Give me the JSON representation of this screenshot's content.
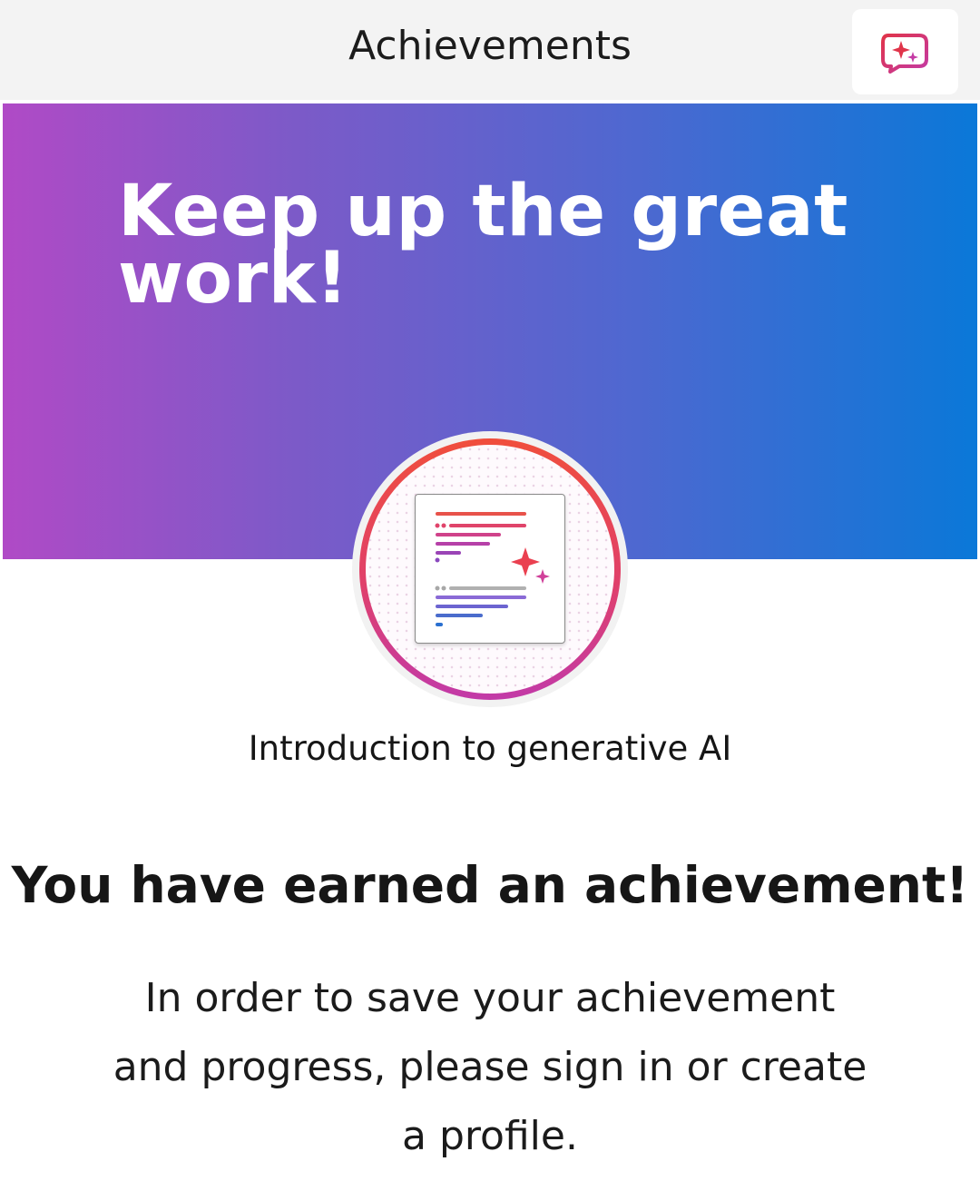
{
  "header": {
    "title": "Achievements",
    "copilot_icon": "copilot-chat-sparkle-icon"
  },
  "banner": {
    "heading": "Keep up the great work!",
    "gradient_colors": [
      "#b04ac6",
      "#7c5ac8",
      "#4e68d0",
      "#0a78d8"
    ]
  },
  "badge": {
    "icon": "document-sparkle-badge-icon",
    "ring_colors": [
      "#f04e3c",
      "#c23aa8"
    ]
  },
  "module": {
    "title": "Introduction to generative AI"
  },
  "achievement": {
    "heading": "You have earned an achievement!",
    "message": "In order to save your achievement and progress, please sign in or create a profile."
  }
}
